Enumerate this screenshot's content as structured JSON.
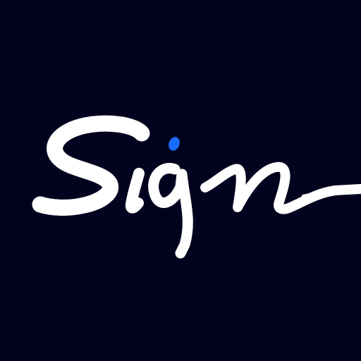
{
  "logo": {
    "wordmark": "Sign",
    "icon": "signature-logo-icon"
  },
  "colors": {
    "background": "#02021e",
    "stroke": "#ffffff",
    "accent_dot": "#1a6cff"
  }
}
